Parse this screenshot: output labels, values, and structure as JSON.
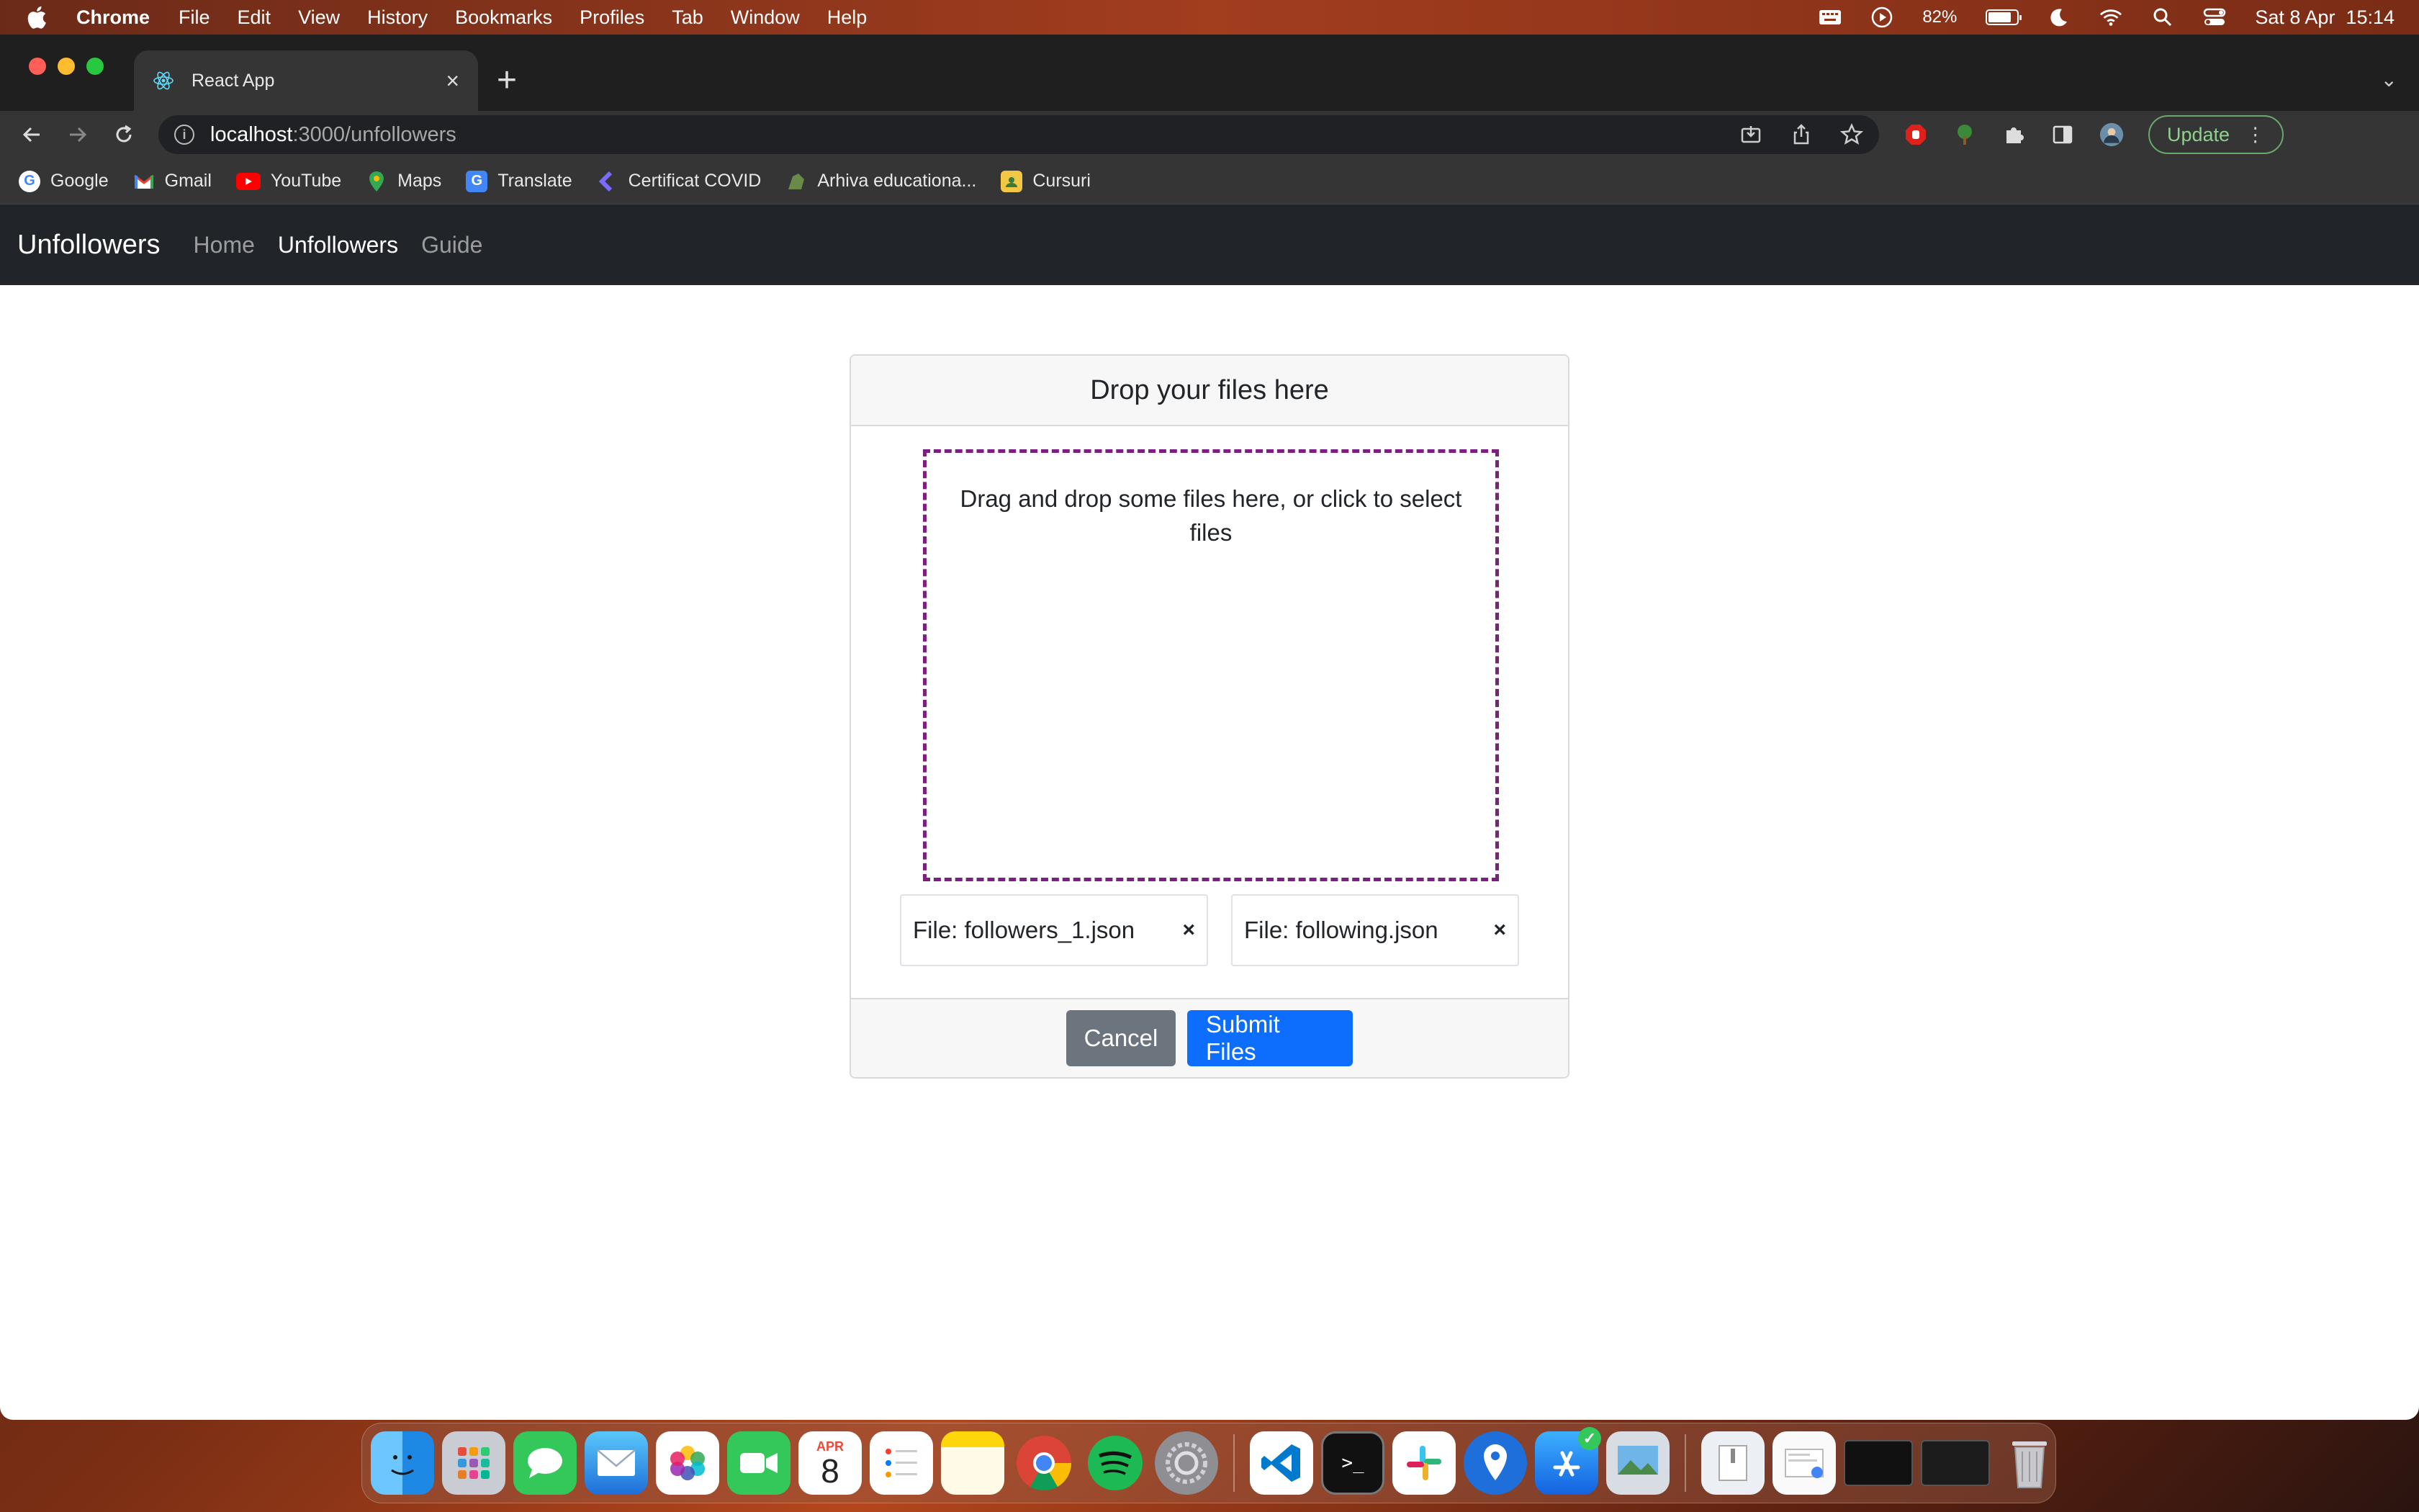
{
  "menubar": {
    "app_name": "Chrome",
    "items": [
      "File",
      "Edit",
      "View",
      "History",
      "Bookmarks",
      "Profiles",
      "Tab",
      "Window",
      "Help"
    ],
    "battery_percent": "82%",
    "battery_level": 0.82,
    "datetime": "Sat 8 Apr  15:14"
  },
  "browser": {
    "tab_title": "React App",
    "url_host": "localhost",
    "url_path": ":3000/unfollowers",
    "update_label": "Update",
    "bookmarks": [
      {
        "label": "Google",
        "icon": "google-icon"
      },
      {
        "label": "Gmail",
        "icon": "gmail-icon"
      },
      {
        "label": "YouTube",
        "icon": "youtube-icon"
      },
      {
        "label": "Maps",
        "icon": "maps-icon"
      },
      {
        "label": "Translate",
        "icon": "translate-icon"
      },
      {
        "label": "Certificat COVID",
        "icon": "covid-cert-icon"
      },
      {
        "label": "Arhiva educationa...",
        "icon": "archive-icon"
      },
      {
        "label": "Cursuri",
        "icon": "folder-icon"
      }
    ]
  },
  "app": {
    "brand": "Unfollowers",
    "nav": [
      "Home",
      "Unfollowers",
      "Guide"
    ],
    "active_nav": "Unfollowers",
    "card": {
      "title": "Drop your files here",
      "dropzone_text": "Drag and drop some files here, or click to select files",
      "files": [
        {
          "label": "File: followers_1.json",
          "remove": "×"
        },
        {
          "label": "File: following.json",
          "remove": "×"
        }
      ],
      "cancel_label": "Cancel",
      "submit_label": "Submit Files"
    }
  },
  "dock": {
    "calendar_month": "APR",
    "calendar_day": "8"
  },
  "colors": {
    "navbar_bg": "#212529",
    "dropzone_border": "#7b1f80",
    "primary": "#0d6efd",
    "secondary": "#6c757d"
  }
}
